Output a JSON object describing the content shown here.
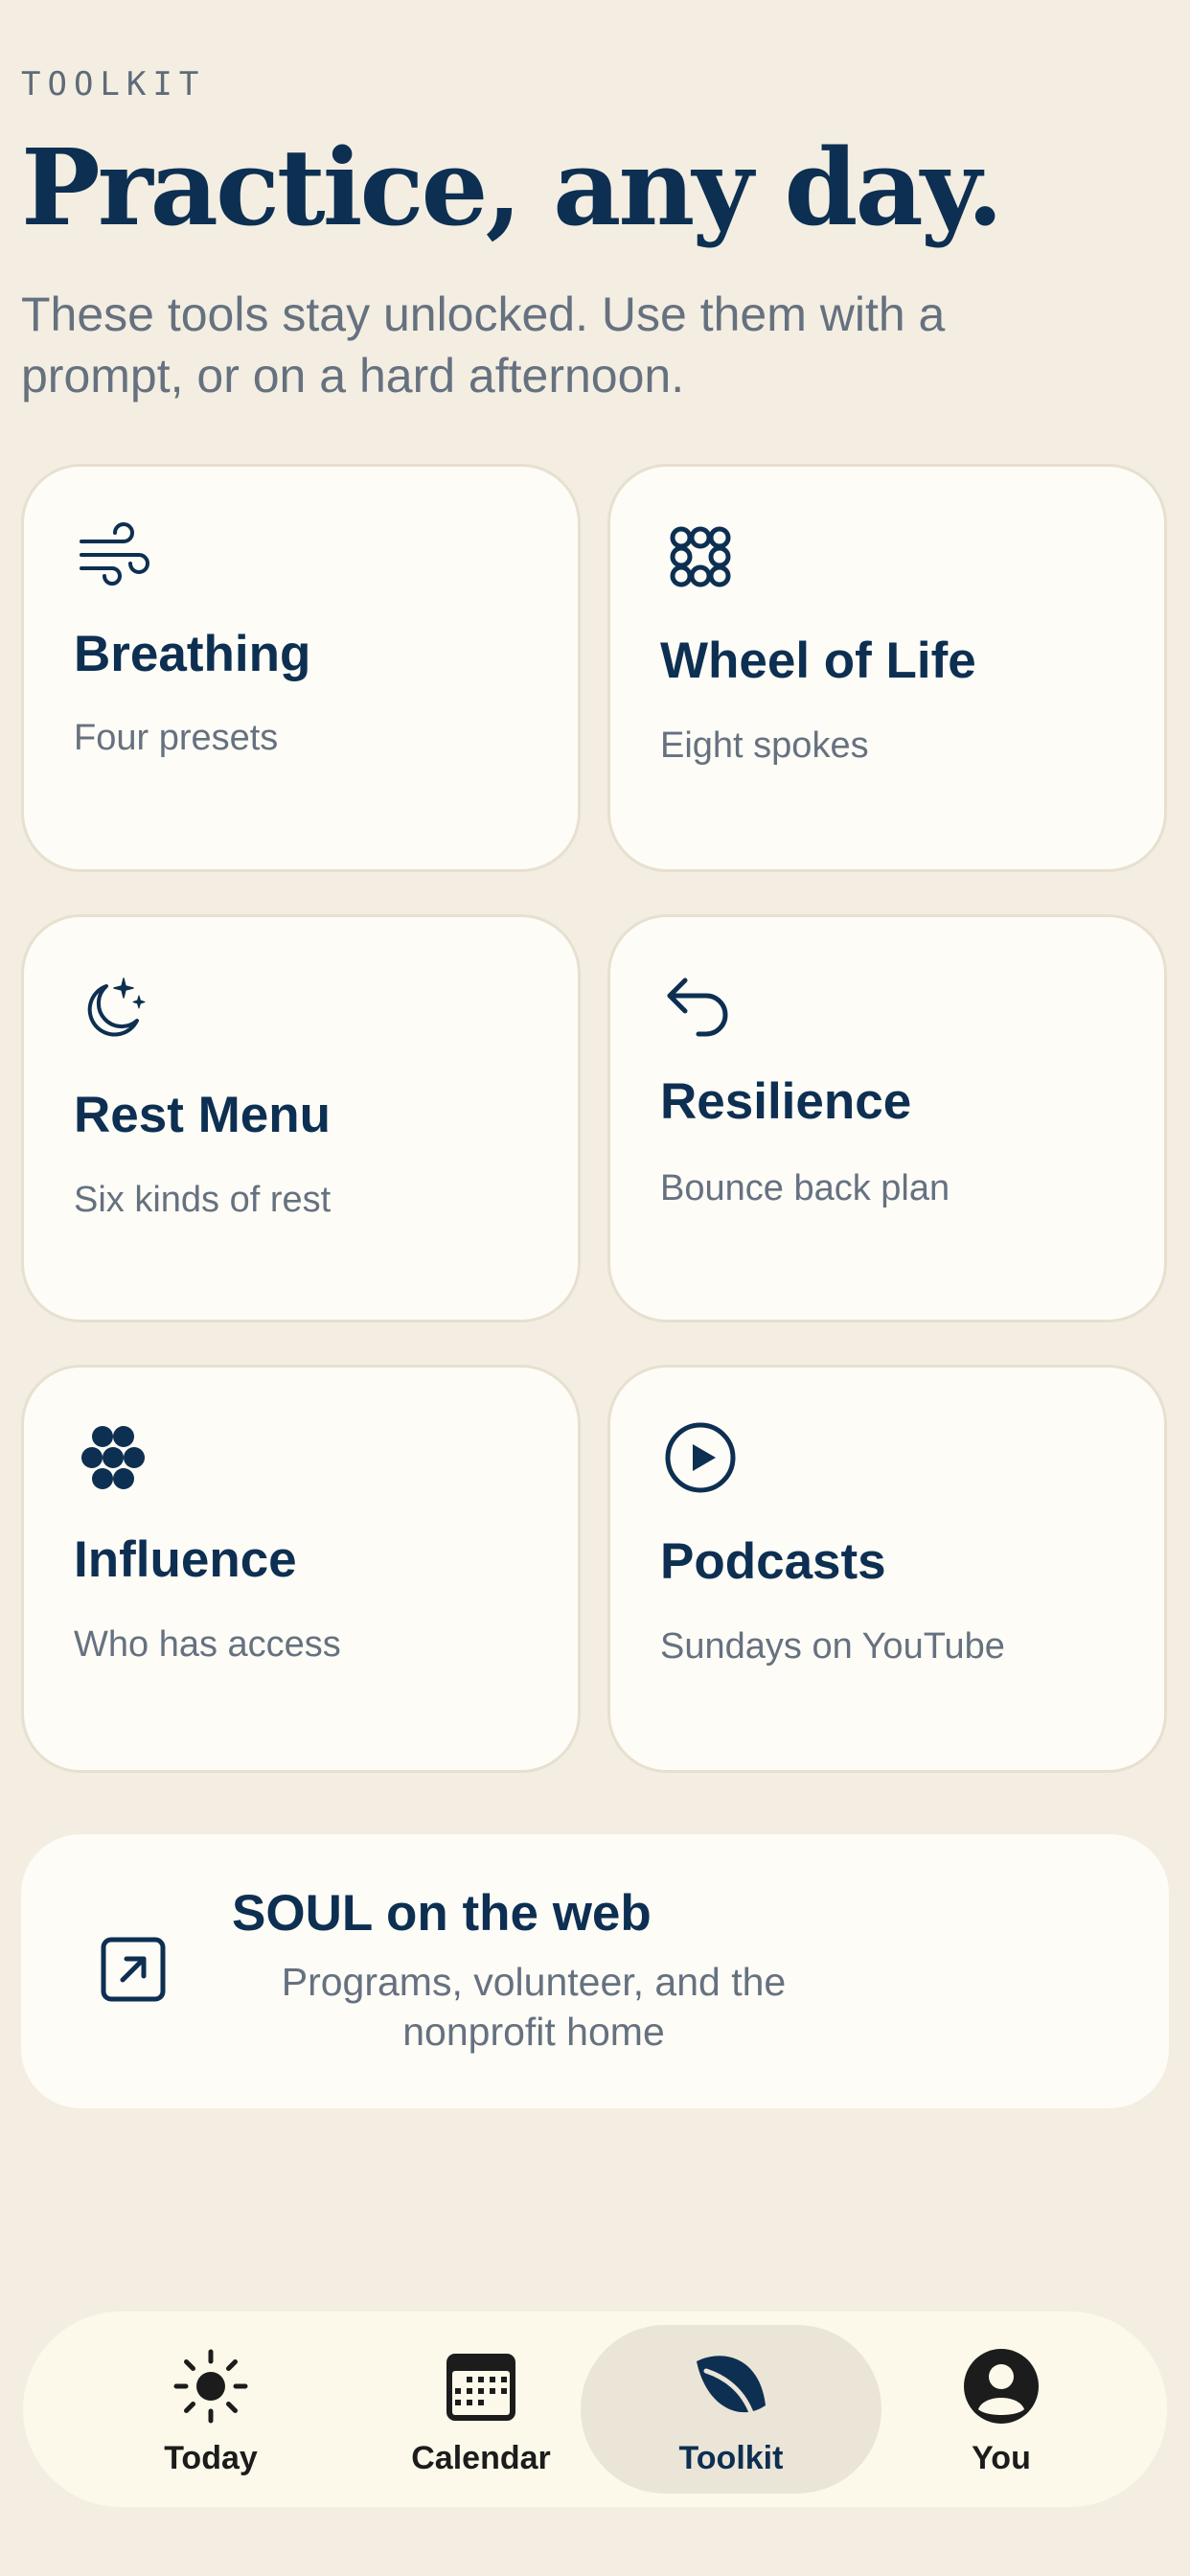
{
  "header": {
    "eyebrow": "TOOLKIT",
    "title": "Practice, any day.",
    "subtitle": "These tools stay unlocked. Use them with a prompt, or on a hard afternoon."
  },
  "tools": [
    {
      "icon": "wind-icon",
      "title": "Breathing",
      "subtitle": "Four presets"
    },
    {
      "icon": "flower-icon",
      "title": "Wheel of Life",
      "subtitle": "Eight spokes"
    },
    {
      "icon": "moon-stars-icon",
      "title": "Rest Menu",
      "subtitle": "Six kinds of rest"
    },
    {
      "icon": "arrow-back-icon",
      "title": "Resilience",
      "subtitle": "Bounce back plan"
    },
    {
      "icon": "circles-cluster-icon",
      "title": "Influence",
      "subtitle": "Who has access"
    },
    {
      "icon": "play-circle-icon",
      "title": "Podcasts",
      "subtitle": "Sundays on YouTube"
    }
  ],
  "web_link": {
    "icon": "external-link-icon",
    "title": "SOUL on the web",
    "subtitle": "Programs, volunteer, and the nonprofit home"
  },
  "tabbar": {
    "active": "Toolkit",
    "tabs": [
      {
        "icon": "sun-icon",
        "label": "Today"
      },
      {
        "icon": "calendar-icon",
        "label": "Calendar"
      },
      {
        "icon": "leaf-icon",
        "label": "Toolkit"
      },
      {
        "icon": "person-icon",
        "label": "You"
      }
    ]
  },
  "colors": {
    "background": "#f3eee1",
    "card": "#fdfcf6",
    "primary": "#0d2f52",
    "muted": "#667180",
    "tab_active": "#ebe5d7"
  }
}
